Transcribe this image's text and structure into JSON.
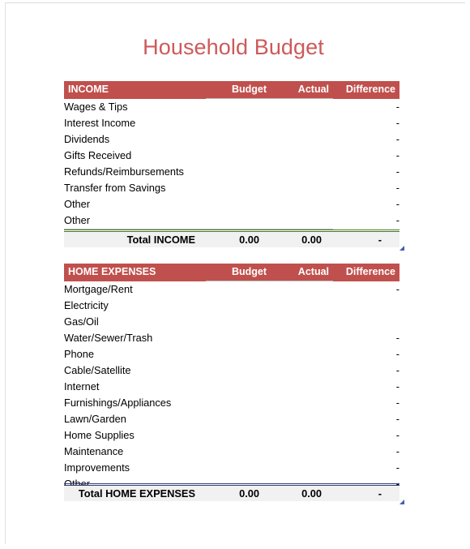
{
  "document": {
    "title": "Household Budget"
  },
  "theme": {
    "header_red": "#c0504d",
    "title_red": "#cc5a5a",
    "difference_fill": "#f1f1f1",
    "income_total_rule": "#4a7a26",
    "expenses_total_rule": "#2b3f7a",
    "grid_line": "#b9b9b9"
  },
  "sections": [
    {
      "id": "income",
      "headers": {
        "category": "INCOME",
        "budget": "Budget",
        "actual": "Actual",
        "difference": "Difference"
      },
      "rows": [
        {
          "label": "Wages & Tips",
          "budget": "",
          "actual": "",
          "difference": "-"
        },
        {
          "label": "Interest Income",
          "budget": "",
          "actual": "",
          "difference": "-"
        },
        {
          "label": "Dividends",
          "budget": "",
          "actual": "",
          "difference": "-"
        },
        {
          "label": "Gifts Received",
          "budget": "",
          "actual": "",
          "difference": "-"
        },
        {
          "label": "Refunds/Reimbursements",
          "budget": "",
          "actual": "",
          "difference": "-"
        },
        {
          "label": "Transfer from Savings",
          "budget": "",
          "actual": "",
          "difference": "-"
        },
        {
          "label": "Other",
          "budget": "",
          "actual": "",
          "difference": "-"
        },
        {
          "label": "Other",
          "budget": "",
          "actual": "",
          "difference": "-"
        }
      ],
      "total": {
        "label": "Total INCOME",
        "budget": "0.00",
        "actual": "0.00",
        "difference": "-"
      }
    },
    {
      "id": "home_expenses",
      "headers": {
        "category": "HOME EXPENSES",
        "budget": "Budget",
        "actual": "Actual",
        "difference": "Difference"
      },
      "rows": [
        {
          "label": "Mortgage/Rent",
          "budget": "",
          "actual": "",
          "difference": "-"
        },
        {
          "label": "Electricity",
          "budget": "",
          "actual": "",
          "difference": ""
        },
        {
          "label": "Gas/Oil",
          "budget": "",
          "actual": "",
          "difference": ""
        },
        {
          "label": "Water/Sewer/Trash",
          "budget": "",
          "actual": "",
          "difference": "-"
        },
        {
          "label": "Phone",
          "budget": "",
          "actual": "",
          "difference": "-"
        },
        {
          "label": "Cable/Satellite",
          "budget": "",
          "actual": "",
          "difference": "-"
        },
        {
          "label": "Internet",
          "budget": "",
          "actual": "",
          "difference": "-"
        },
        {
          "label": "Furnishings/Appliances",
          "budget": "",
          "actual": "",
          "difference": "-"
        },
        {
          "label": "Lawn/Garden",
          "budget": "",
          "actual": "",
          "difference": "-"
        },
        {
          "label": "Home Supplies",
          "budget": "",
          "actual": "",
          "difference": "-"
        },
        {
          "label": "Maintenance",
          "budget": "",
          "actual": "",
          "difference": "-"
        },
        {
          "label": "Improvements",
          "budget": "",
          "actual": "",
          "difference": "-"
        },
        {
          "label": "Other",
          "budget": "",
          "actual": "",
          "difference": "-"
        }
      ],
      "total": {
        "label": "Total HOME EXPENSES",
        "budget": "0.00",
        "actual": "0.00",
        "difference": "-"
      }
    }
  ]
}
